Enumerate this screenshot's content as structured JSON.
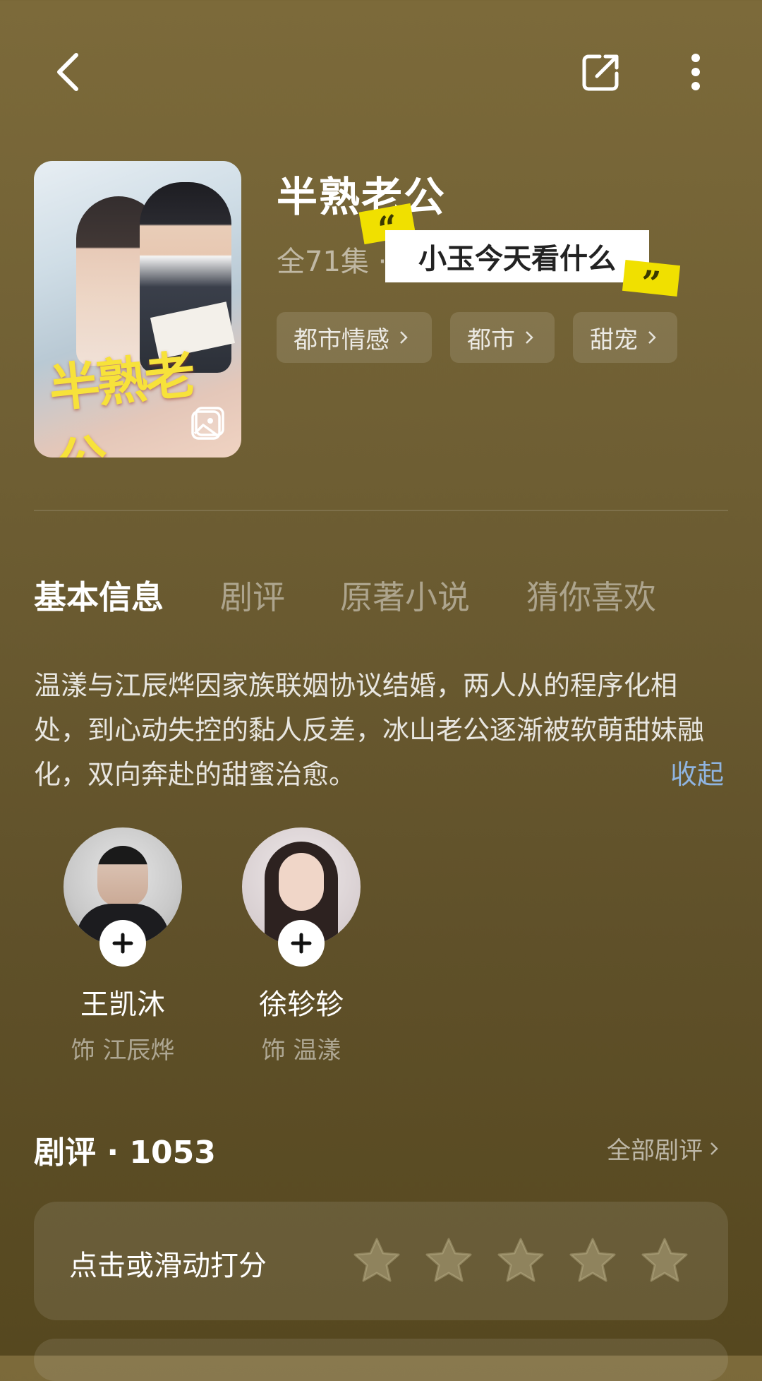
{
  "colors": {
    "accent_link": "#8fb4e0",
    "quote_highlight": "#f0e000"
  },
  "top_bar": {
    "back_icon": "chevron-left-icon",
    "share_icon": "share-icon",
    "more_icon": "more-vertical-icon"
  },
  "poster": {
    "title_art": "半熟老公",
    "gallery_icon": "gallery-icon"
  },
  "show": {
    "title": "半熟老公",
    "episodes": "全71集 ·",
    "quote_label": "小玉今天看什么",
    "tags": [
      {
        "label": "都市情感"
      },
      {
        "label": "都市"
      },
      {
        "label": "甜宠"
      }
    ]
  },
  "tabs": [
    {
      "label": "基本信息",
      "active": true
    },
    {
      "label": "剧评"
    },
    {
      "label": "原著小说"
    },
    {
      "label": "猜你喜欢"
    }
  ],
  "description": {
    "text": "温漾与江辰烨因家族联姻协议结婚，两人从的程序化相处，到心动失控的黏人反差，冰山老公逐渐被软萌甜妹融化，双向奔赴的甜蜜治愈。",
    "collapse_label": "收起"
  },
  "cast": [
    {
      "name": "王凯沐",
      "role": "饰 江辰烨"
    },
    {
      "name": "徐轸轸",
      "role": "饰 温漾"
    }
  ],
  "reviews": {
    "title": "剧评 · 1053",
    "all_label": "全部剧评",
    "rating_prompt": "点击或滑动打分",
    "stars": 5
  }
}
